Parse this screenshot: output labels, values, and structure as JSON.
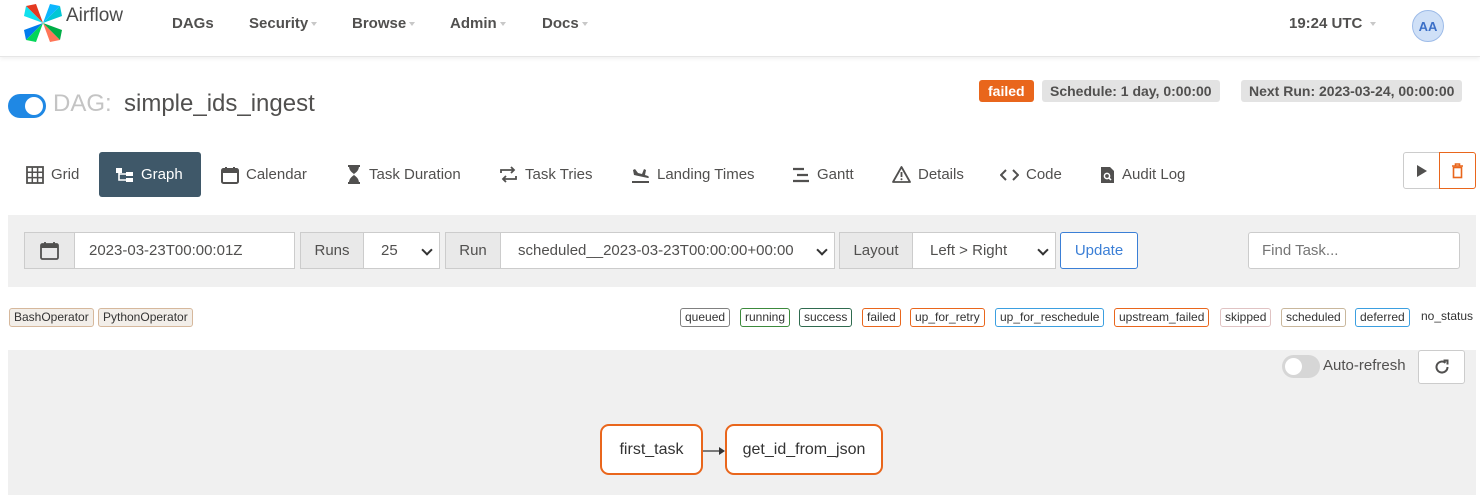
{
  "navbar": {
    "brand": "Airflow",
    "menu": [
      "DAGs",
      "Security",
      "Browse",
      "Admin",
      "Docs"
    ],
    "clock": "19:24 UTC",
    "avatar": "AA"
  },
  "dag": {
    "prefix": "DAG:",
    "name": "simple_ids_ingest",
    "state": "failed",
    "schedule": "Schedule: 1 day, 0:00:00",
    "next_run": "Next Run: 2023-03-24, 00:00:00",
    "paused": false
  },
  "tabs": [
    {
      "label": "Grid",
      "icon": "grid-icon"
    },
    {
      "label": "Graph",
      "icon": "graph-icon",
      "active": true
    },
    {
      "label": "Calendar",
      "icon": "calendar-icon"
    },
    {
      "label": "Task Duration",
      "icon": "hourglass-icon"
    },
    {
      "label": "Task Tries",
      "icon": "repeat-icon"
    },
    {
      "label": "Landing Times",
      "icon": "plane-landing-icon"
    },
    {
      "label": "Gantt",
      "icon": "gantt-icon"
    },
    {
      "label": "Details",
      "icon": "warning-triangle-icon"
    },
    {
      "label": "Code",
      "icon": "code-icon"
    },
    {
      "label": "Audit Log",
      "icon": "document-search-icon"
    }
  ],
  "filters": {
    "date": "2023-03-23T00:00:01Z",
    "runs_label": "Runs",
    "runs_value": "25",
    "run_label": "Run",
    "run_value": "scheduled__2023-03-23T00:00:00+00:00",
    "layout_label": "Layout",
    "layout_value": "Left > Right",
    "update": "Update",
    "find_placeholder": "Find Task..."
  },
  "operators": [
    "BashOperator",
    "PythonOperator"
  ],
  "states": [
    {
      "label": "queued",
      "color": "#808080"
    },
    {
      "label": "running",
      "color": "#00aa00"
    },
    {
      "label": "success",
      "color": "#008000"
    },
    {
      "label": "failed",
      "color": "#ff0000"
    },
    {
      "label": "up_for_retry",
      "color": "#ffd700"
    },
    {
      "label": "up_for_reschedule",
      "color": "#40e0d0"
    },
    {
      "label": "upstream_failed",
      "color": "#ffa500"
    },
    {
      "label": "skipped",
      "color": "#ffc0cb"
    },
    {
      "label": "scheduled",
      "color": "#d2b48c"
    },
    {
      "label": "deferred",
      "color": "#9370db"
    },
    {
      "label": "no_status",
      "color": ""
    }
  ],
  "graph": {
    "auto_refresh": "Auto-refresh",
    "nodes": [
      "first_task",
      "get_id_from_json"
    ]
  },
  "colors": {
    "accent": "#1f88e4",
    "failed": "#e9661c",
    "active_tab": "#3f5869"
  }
}
